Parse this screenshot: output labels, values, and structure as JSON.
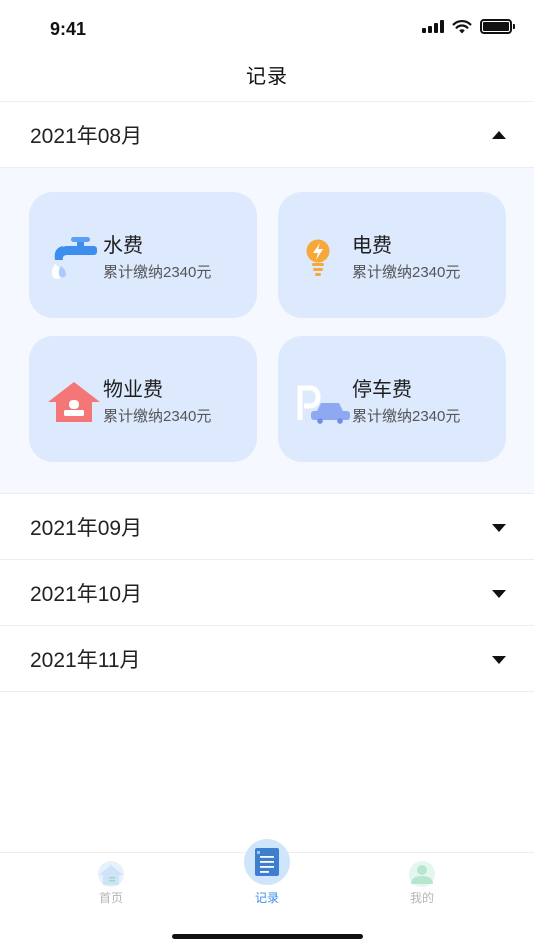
{
  "status_bar": {
    "time": "9:41",
    "signal_icon": "cellular-signal-icon",
    "wifi_icon": "wifi-icon",
    "battery_icon": "battery-icon"
  },
  "nav": {
    "title": "记录"
  },
  "months": [
    {
      "label": "2021年08月",
      "expanded": true,
      "caret_icon": "caret-up-icon"
    },
    {
      "label": "2021年09月",
      "expanded": false,
      "caret_icon": "caret-down-icon"
    },
    {
      "label": "2021年10月",
      "expanded": false,
      "caret_icon": "caret-down-icon"
    },
    {
      "label": "2021年11月",
      "expanded": false,
      "caret_icon": "caret-down-icon"
    }
  ],
  "fees": [
    {
      "title": "水费",
      "summary": "累计缴纳2340元",
      "icon": "faucet-icon"
    },
    {
      "title": "电费",
      "summary": "累计缴纳2340元",
      "icon": "lightbulb-icon"
    },
    {
      "title": "物业费",
      "summary": "累计缴纳2340元",
      "icon": "house-icon"
    },
    {
      "title": "停车费",
      "summary": "累计缴纳2340元",
      "icon": "parking-car-icon"
    }
  ],
  "tabs": [
    {
      "label": "首页",
      "icon": "home-icon",
      "active": false
    },
    {
      "label": "记录",
      "icon": "notebook-icon",
      "active": true
    },
    {
      "label": "我的",
      "icon": "profile-icon",
      "active": false
    }
  ],
  "colors": {
    "accent": "#3f8de8",
    "card_bg": "#dde9fd",
    "panel_bg": "#f5f9ff"
  }
}
